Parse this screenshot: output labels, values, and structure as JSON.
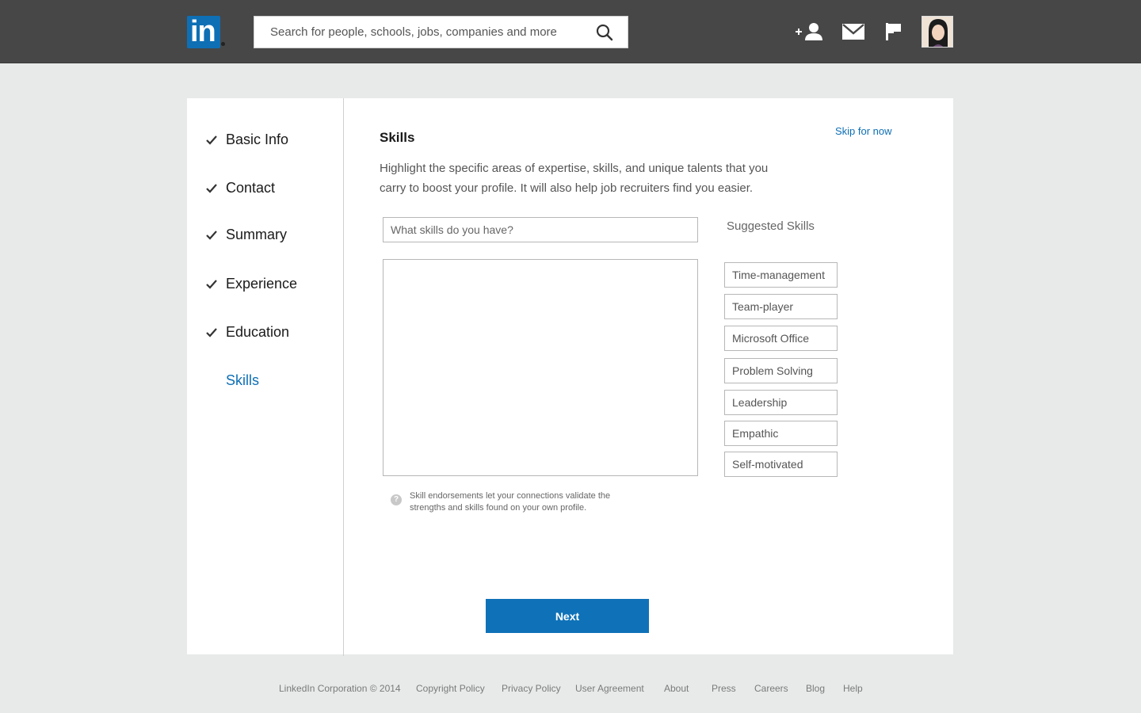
{
  "header": {
    "logo_text": "in",
    "search_placeholder": "Search for people, schools, jobs, companies and more",
    "icons": [
      "search-icon",
      "add-connection-icon",
      "mail-icon",
      "flag-icon"
    ]
  },
  "steps": [
    {
      "label": "Basic Info",
      "done": true
    },
    {
      "label": "Contact",
      "done": true
    },
    {
      "label": "Summary",
      "done": true
    },
    {
      "label": "Experience",
      "done": true
    },
    {
      "label": "Education",
      "done": true
    },
    {
      "label": "Skills",
      "done": false,
      "active": true
    }
  ],
  "main": {
    "title": "Skills",
    "skip_label": "Skip for now",
    "description": "Highlight the specific areas of expertise,  skills, and unique talents that you carry to boost your profile. It will also help job recruiters find you easier.",
    "skill_input_placeholder": "What skills do you have?",
    "hint": "Skill endorsements let your connections validate the strengths and skills found on your own profile.",
    "hint_icon": "?",
    "suggested_title": "Suggested Skills",
    "suggested_skills": [
      "Time-management",
      "Team-player",
      "Microsoft Office",
      "Problem Solving",
      "Leadership",
      "Empathic",
      "Self-motivated"
    ],
    "next_label": "Next"
  },
  "footer": {
    "copyright": "LinkedIn Corporation © 2014",
    "links": [
      "Copyright Policy",
      "Privacy Policy",
      "User Agreement",
      "About",
      "Press",
      "Careers",
      "Blog",
      "Help"
    ]
  },
  "colors": {
    "brand_blue": "#0e6fb5",
    "header_bg": "#474747",
    "page_bg": "#e8eaea"
  }
}
